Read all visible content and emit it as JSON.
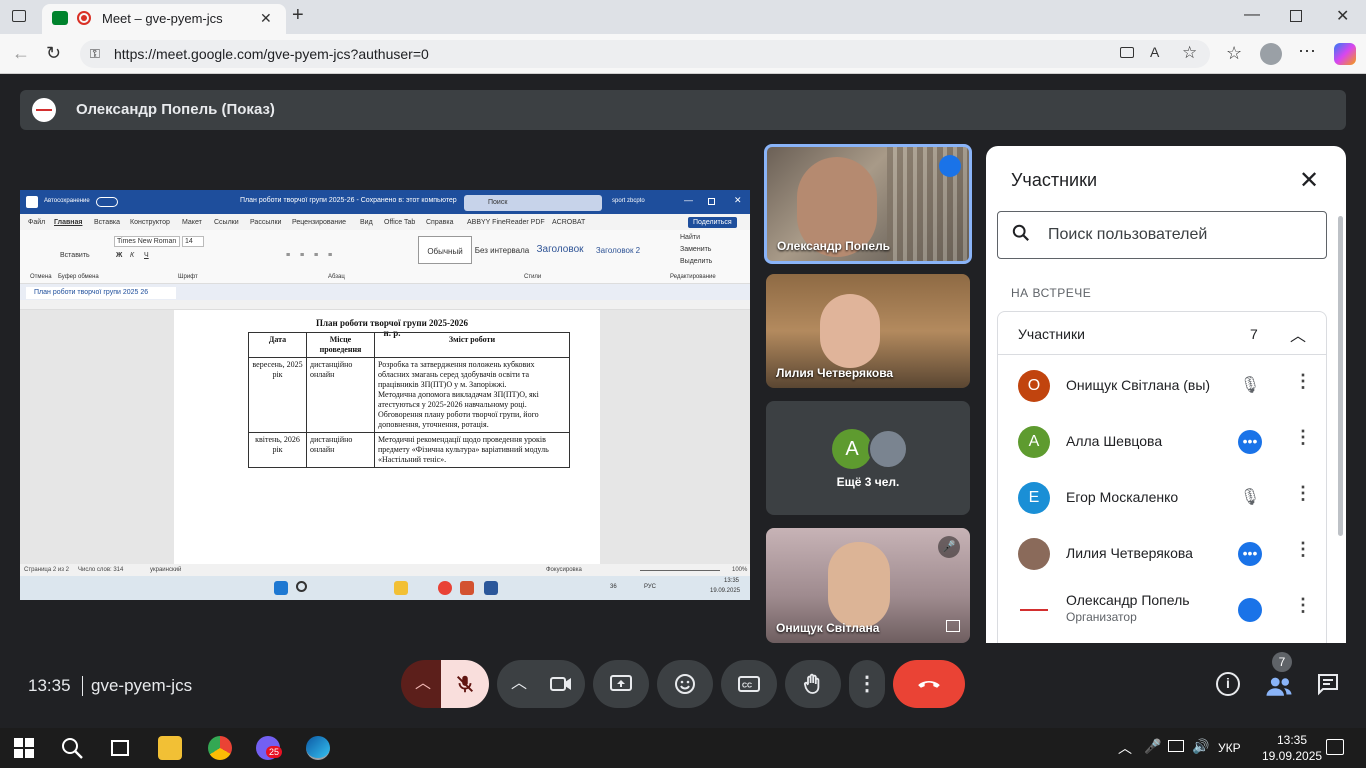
{
  "browser": {
    "tab_title": "Meet – gve-pyem-jcs",
    "url": "https://meet.google.com/gve-pyem-jcs?authuser=0",
    "new_tab": "+"
  },
  "meet": {
    "presenting_banner": "Олександр Попель (Показ)",
    "time": "13:35",
    "meeting_code": "gve-pyem-jcs",
    "people_badge": "7"
  },
  "word": {
    "autosave": "Автосохранение",
    "title": "План роботи творчої групи 2025-26 - Сохранено в: этот компьютер",
    "search": "Поиск",
    "user": "sport zbcpto",
    "share": "Поделиться",
    "menu": [
      "Файл",
      "Главная",
      "Вставка",
      "Конструктор",
      "Макет",
      "Ссылки",
      "Рассылки",
      "Рецензирование",
      "Вид",
      "Office Tab",
      "Справка",
      "ABBYY FineReader PDF",
      "ACROBAT"
    ],
    "font_name": "Times New Roman",
    "font_size": "14",
    "styles": [
      "Обычный",
      "Без интервала",
      "Заголовок",
      "Заголовок 2"
    ],
    "find": "Найти",
    "replace": "Заменить",
    "select": "Выделить",
    "groups": [
      "Отмена",
      "Буфер обмена",
      "Шрифт",
      "Абзац",
      "Стили",
      "Редактирование"
    ],
    "paste": "Вставить",
    "doc_tab": "План роботи творчої групи 2025 26",
    "doc_heading": "План роботи творчої групи 2025-2026 н. р.",
    "table": {
      "headers": [
        "Дата",
        "Місце проведення",
        "Зміст роботи"
      ],
      "rows": [
        {
          "date": "вересень, 2025 рік",
          "place": "дистанційно онлайн",
          "content": [
            "Розробка та затвердження положень кубкових обласних змагань серед здобувачів освіти та працівників ЗП(ПТ)О у м. Запоріжжі.",
            "Методична допомога викладачам ЗП(ПТ)О, які атестуються у 2025-2026 навчальному році.",
            "Обговорення плану роботи творчої групи, його доповнення, уточнення, ротація."
          ]
        },
        {
          "date": "квітень, 2026 рік",
          "place": "дистанційно онлайн",
          "content": [
            "Методичні рекомендації щодо проведення уроків предмету «Фізична культура» варіативний модуль «Настільний теніс»."
          ]
        }
      ]
    },
    "status_page": "Страница 2 из 2",
    "status_words": "Число слов: 314",
    "status_lang": "украинский",
    "status_focus": "Фокусировка",
    "status_zoom": "100%",
    "inner_time": "13:35",
    "inner_date": "19.09.2025",
    "inner_lang": "РУС",
    "inner_temp": "36"
  },
  "tiles": [
    {
      "name": "Олександр Попель"
    },
    {
      "name": "Лилия Четверякова"
    },
    {
      "name": "Ещё 3 чел.",
      "avatar_letter": "A"
    },
    {
      "name": "Онищук Світлана"
    }
  ],
  "people_panel": {
    "title": "Участники",
    "search_placeholder": "Поиск пользователей",
    "section": "НА ВСТРЕЧЕ",
    "group_label": "Участники",
    "group_count": "7",
    "participants": [
      {
        "initial": "О",
        "name": "Онищук Світлана (вы)",
        "color": "#c1440e",
        "status": "muted"
      },
      {
        "initial": "А",
        "name": "Алла Шевцова",
        "color": "#5e9b2f",
        "status": "more"
      },
      {
        "initial": "Е",
        "name": "Егор Москаленко",
        "color": "#1a8fd6",
        "status": "muted"
      },
      {
        "initial": "",
        "name": "Лилия Четверякова",
        "color": "#8a6a5a",
        "status": "more"
      },
      {
        "initial": "",
        "name": "Олександр Попель",
        "subtitle": "Организатор",
        "color": "#ffffff",
        "status": "speaking"
      }
    ]
  },
  "taskbar": {
    "lang": "УКР",
    "time": "13:35",
    "date": "19.09.2025",
    "badge": "25"
  },
  "colors": {
    "meet_bg": "#202124",
    "accent_blue": "#1a73e8",
    "end_call": "#ea4335",
    "mic_off": "#f9dedc"
  }
}
